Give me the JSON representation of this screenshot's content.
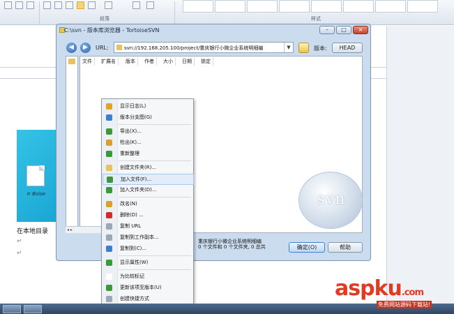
{
  "ribbon": {
    "group_paragraph": "段落",
    "group_styles": "样式"
  },
  "document": {
    "file_label": "Ir Boise",
    "text": "在本地目录",
    "para_mark": "↵"
  },
  "window": {
    "title": "C:\\svn - 版本库浏览器 - TortoiseSVN",
    "controls": {
      "minimize": "–",
      "maximize": "□",
      "close": "×"
    },
    "nav": {
      "back": "◀",
      "forward": "▶"
    },
    "url_label": "URL:",
    "url_value": "svn://192.168.205.100/project/重庆银行小微企业系统明细编",
    "revision_label": "版本:",
    "revision_value": "HEAD",
    "columns": [
      "文件",
      "扩展名",
      "版本",
      "作者",
      "大小",
      "日期",
      "锁定"
    ],
    "status_line1": "重庆银行小微企业系统明细编",
    "status_line2": "0 个文件和 0 个文件夹, 0 总共",
    "ok_button": "确定(O)",
    "help_button": "帮助",
    "logo_text": "svn"
  },
  "context_menu": {
    "items": [
      {
        "label": "显示日志(L)",
        "icon": "log-icon",
        "color": "#e0a526"
      },
      {
        "label": "版本分支图(G)",
        "icon": "graph-icon",
        "color": "#3b7fd0"
      },
      {
        "label": "导出(X)...",
        "icon": "export-icon",
        "color": "#3a9a3a"
      },
      {
        "label": "检出(K)...",
        "icon": "checkout-icon",
        "color": "#d8a12b"
      },
      {
        "label": "重新整理",
        "icon": "refresh-icon",
        "color": "#3a9a3a"
      },
      {
        "label": "创建文件夹(R)...",
        "icon": "folder-icon",
        "color": "#e7c35a"
      },
      {
        "label": "加入文件(F)...",
        "icon": "add-file-icon",
        "color": "#3a9a3a"
      },
      {
        "label": "加入文件夹(D)...",
        "icon": "add-folder-icon",
        "color": "#3a9a3a"
      },
      {
        "label": "改名(N)",
        "icon": "rename-icon",
        "color": "#d8a12b"
      },
      {
        "label": "删除(D) ...",
        "icon": "delete-icon",
        "color": "#d22b2b"
      },
      {
        "label": "复制 URL",
        "icon": "copy-url-icon",
        "color": "#9aa8b8"
      },
      {
        "label": "复制到工作副本...",
        "icon": "copy-wc-icon",
        "color": "#9aa8b8"
      },
      {
        "label": "复制到(C)...",
        "icon": "copy-to-icon",
        "color": "#3b7fd0"
      },
      {
        "label": "显示属性(W)",
        "icon": "properties-icon",
        "color": "#3a9a3a"
      },
      {
        "label": "为比较标记",
        "icon": "mark-icon",
        "color": "#ffffff"
      },
      {
        "label": "更新该项至版本(U)",
        "icon": "update-icon",
        "color": "#3a9a3a"
      },
      {
        "label": "创建快捷方式",
        "icon": "shortcut-icon",
        "color": "#9aa8b8"
      }
    ],
    "highlighted_index": 6
  },
  "watermark": {
    "brand": "aspku",
    "suffix": ".com",
    "tagline": "免费网站源码下载站!"
  }
}
